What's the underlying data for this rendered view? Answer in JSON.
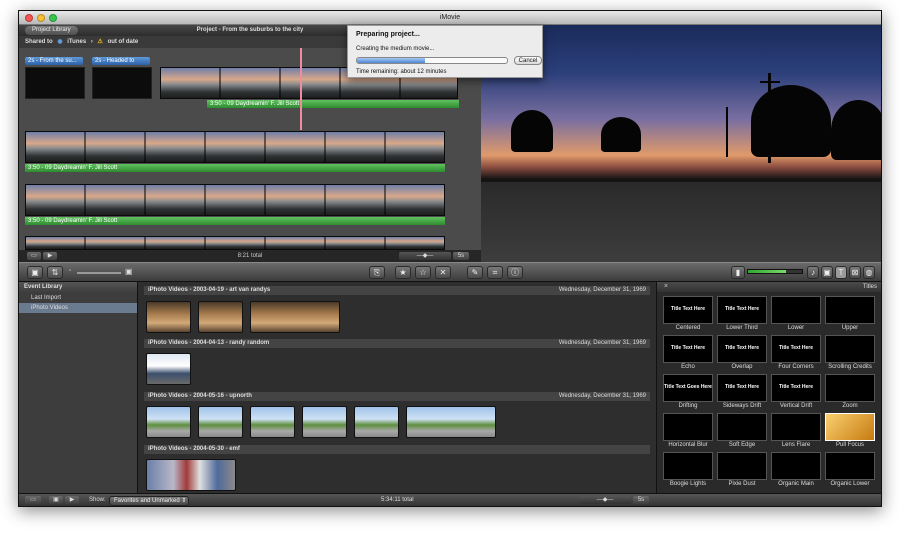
{
  "window": {
    "title": "iMovie"
  },
  "project": {
    "library_button": "Project Library",
    "title": "Project - From the suburbs to the city",
    "shared_to_label": "Shared to",
    "shared_to_service": "iTunes",
    "status": "out of date",
    "tags": [
      "2s - From the su...",
      "2s - Headed to"
    ],
    "audio_label": "3:50 - 09 Daydreamin' F. Jill Scott",
    "total": "8:21 total",
    "zoom_value": "5s"
  },
  "dialog": {
    "title": "Preparing project...",
    "message": "Creating the medium movie...",
    "progress": 0.45,
    "cancel_label": "Cancel",
    "time_remaining": "Time remaining: about 12 minutes"
  },
  "event_library": {
    "title": "Event Library",
    "items": [
      "Last Import",
      "iPhoto Videos"
    ]
  },
  "events": [
    {
      "name": "iPhoto Videos - 2003-04-19 - art van randys",
      "date": "Wednesday, December 31, 1969"
    },
    {
      "name": "iPhoto Videos - 2004-04-13 - randy random",
      "date": "Wednesday, December 31, 1969"
    },
    {
      "name": "iPhoto Videos - 2004-05-16 - upnorth",
      "date": "Wednesday, December 31, 1969"
    },
    {
      "name": "iPhoto Videos - 2004-05-30 - emf",
      "date": "Wednesday, December 31, 1969"
    }
  ],
  "titles": {
    "header": "Titles",
    "items": [
      "Centered",
      "Lower Third",
      "Lower",
      "Upper",
      "Echo",
      "Overlap",
      "Four Corners",
      "Scrolling Credits",
      "Drifting",
      "Sideways Drift",
      "Vertical Drift",
      "Zoom",
      "Horizontal Blur",
      "Soft Edge",
      "Lens Flare",
      "Pull Focus",
      "Boogie Lights",
      "Pixie Dust",
      "Organic Main",
      "Organic Lower"
    ],
    "preview_texts": {
      "title_text_here": "Title Text Here",
      "title_text_goes_here": "Title Text Goes Here"
    },
    "selected": "Pull Focus"
  },
  "bottom": {
    "show_label": "Show:",
    "filter_value": "Favorites and Unmarked",
    "total": "5:34:11 total",
    "zoom_value": "5s"
  },
  "colors": {
    "accent_blue": "#4d88d6",
    "audio_green": "#3fa33f",
    "selection": "#6a7a8f"
  }
}
